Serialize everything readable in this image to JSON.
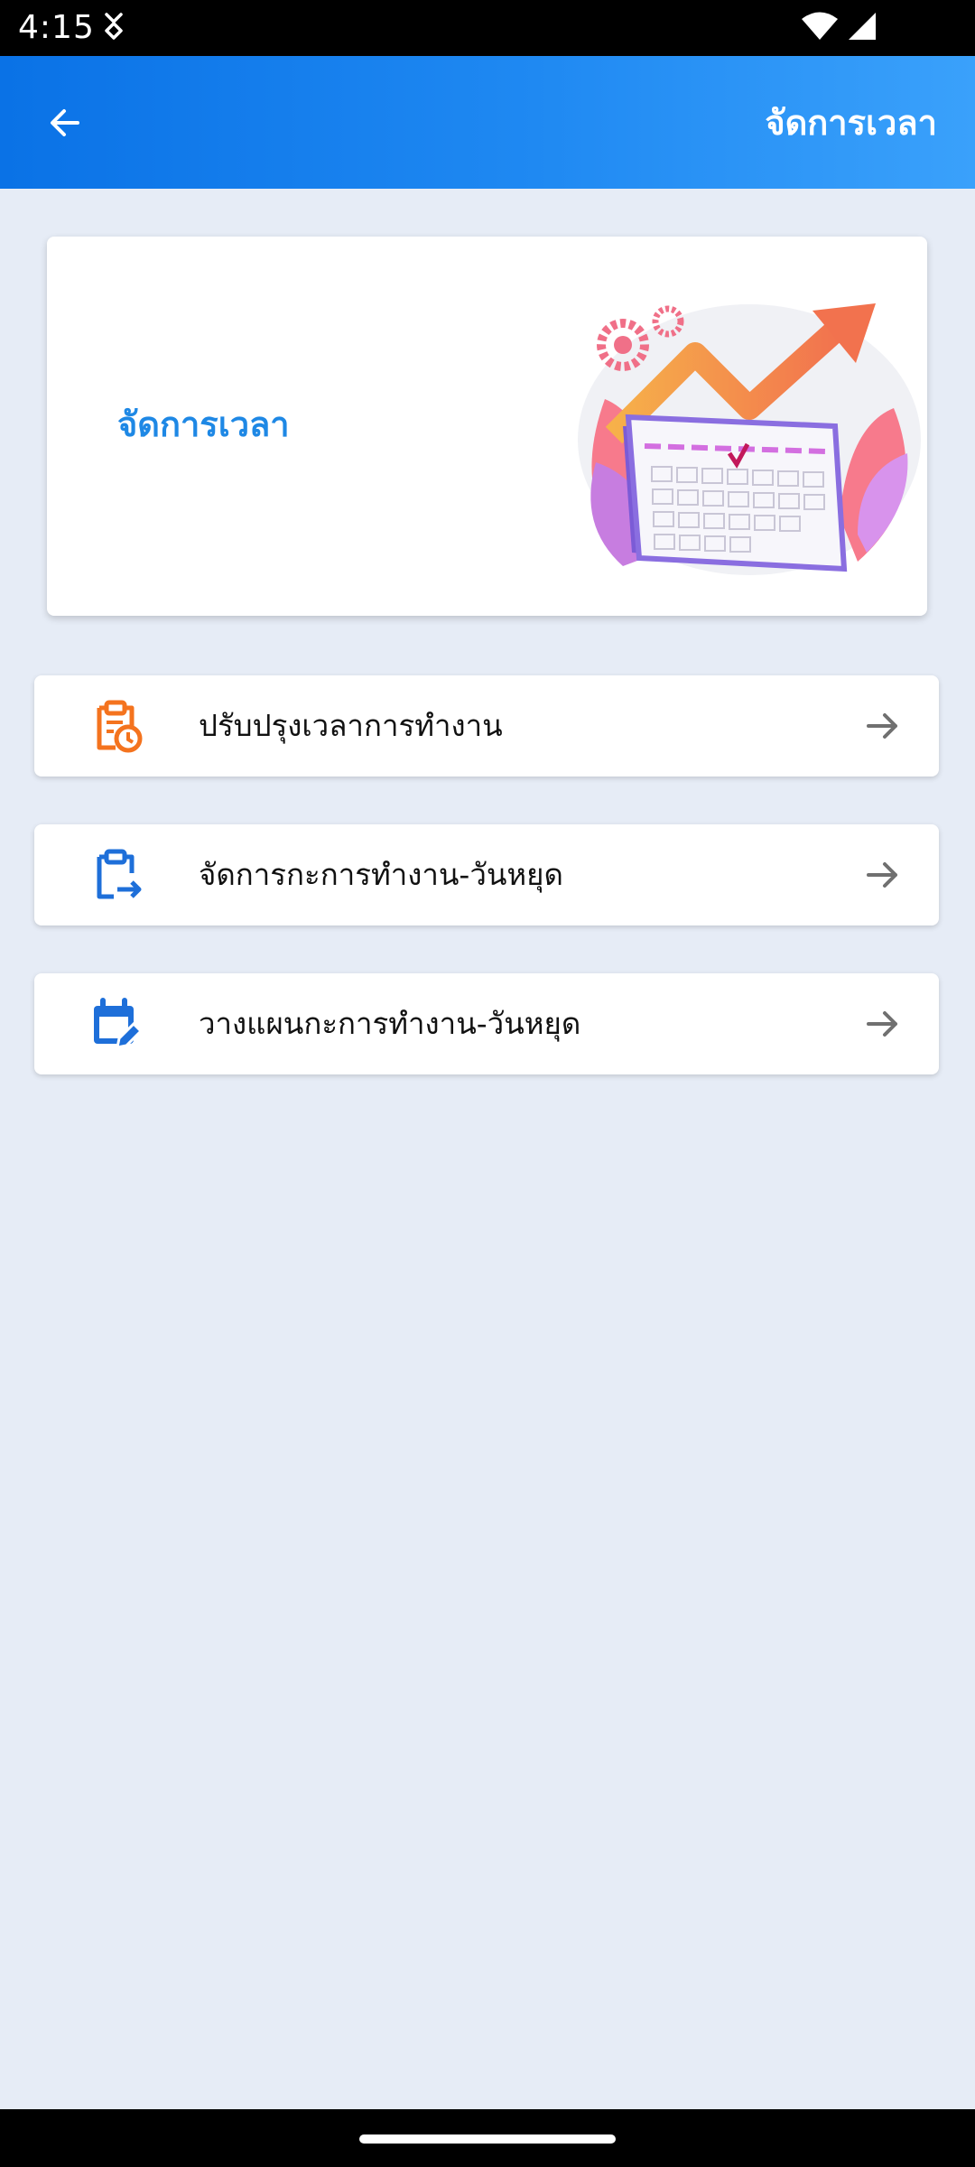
{
  "status_bar": {
    "time": "4:15",
    "icons": [
      "notification-icon",
      "wifi-icon",
      "cell-signal-icon"
    ]
  },
  "app_bar": {
    "title": "จัดการเวลา",
    "back_icon": "arrow-back-icon",
    "gradient_colors": [
      "#0a72e6",
      "#3aa1fb"
    ]
  },
  "hero": {
    "title": "จัดการเวลา",
    "illustration": "calendar-growth-illustration",
    "title_color": "#1e88e5"
  },
  "menu": {
    "items": [
      {
        "label": "ปรับปรุงเวลาการทำงาน",
        "icon": "clipboard-clock-icon",
        "icon_color": "#f4731e"
      },
      {
        "label": "จัดการกะการทำงาน-วันหยุด",
        "icon": "clipboard-swap-icon",
        "icon_color": "#1e6fd9"
      },
      {
        "label": "วางแผนกะการทำงาน-วันหยุด",
        "icon": "calendar-edit-icon",
        "icon_color": "#1e6fd9"
      }
    ],
    "arrow_icon": "arrow-forward-icon"
  },
  "colors": {
    "background": "#e6ecf6",
    "card": "#ffffff"
  }
}
